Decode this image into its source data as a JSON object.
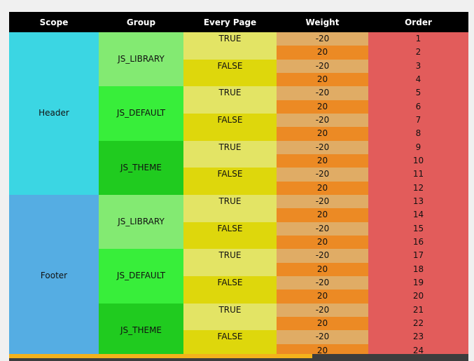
{
  "columns": [
    "Scope",
    "Group",
    "Every Page",
    "Weight",
    "Order"
  ],
  "scopes": [
    {
      "name": "Header",
      "groups": [
        {
          "name": "JS_LIBRARY",
          "every_page": [
            {
              "value": "TRUE",
              "weights": [
                "-20",
                "20"
              ],
              "orders": [
                "1",
                "2"
              ]
            },
            {
              "value": "FALSE",
              "weights": [
                "-20",
                "20"
              ],
              "orders": [
                "3",
                "4"
              ]
            }
          ]
        },
        {
          "name": "JS_DEFAULT",
          "every_page": [
            {
              "value": "TRUE",
              "weights": [
                "-20",
                "20"
              ],
              "orders": [
                "5",
                "6"
              ]
            },
            {
              "value": "FALSE",
              "weights": [
                "-20",
                "20"
              ],
              "orders": [
                "7",
                "8"
              ]
            }
          ]
        },
        {
          "name": "JS_THEME",
          "every_page": [
            {
              "value": "TRUE",
              "weights": [
                "-20",
                "20"
              ],
              "orders": [
                "9",
                "10"
              ]
            },
            {
              "value": "FALSE",
              "weights": [
                "-20",
                "20"
              ],
              "orders": [
                "11",
                "12"
              ]
            }
          ]
        }
      ]
    },
    {
      "name": "Footer",
      "groups": [
        {
          "name": "JS_LIBRARY",
          "every_page": [
            {
              "value": "TRUE",
              "weights": [
                "-20",
                "20"
              ],
              "orders": [
                "13",
                "14"
              ]
            },
            {
              "value": "FALSE",
              "weights": [
                "-20",
                "20"
              ],
              "orders": [
                "15",
                "16"
              ]
            }
          ]
        },
        {
          "name": "JS_DEFAULT",
          "every_page": [
            {
              "value": "TRUE",
              "weights": [
                "-20",
                "20"
              ],
              "orders": [
                "17",
                "18"
              ]
            },
            {
              "value": "FALSE",
              "weights": [
                "-20",
                "20"
              ],
              "orders": [
                "19",
                "20"
              ]
            }
          ]
        },
        {
          "name": "JS_THEME",
          "every_page": [
            {
              "value": "TRUE",
              "weights": [
                "-20",
                "20"
              ],
              "orders": [
                "21",
                "22"
              ]
            },
            {
              "value": "FALSE",
              "weights": [
                "-20",
                "20"
              ],
              "orders": [
                "23",
                "24"
              ]
            }
          ]
        }
      ]
    }
  ],
  "colors": {
    "header_bg": "#000000",
    "scope_header": "#3bd6e3",
    "scope_footer": "#55ade3",
    "group_library": "#83ea72",
    "group_default": "#38ee3a",
    "group_theme": "#20cb1f",
    "every_page_true": "#e3e465",
    "every_page_false": "#ded70c",
    "weight_negative": "#e0ac65",
    "weight_positive": "#ec8a24",
    "order": "#e25c5b",
    "scrollbar_thumb": "#f3b21c"
  },
  "scroll_position": 0.66
}
